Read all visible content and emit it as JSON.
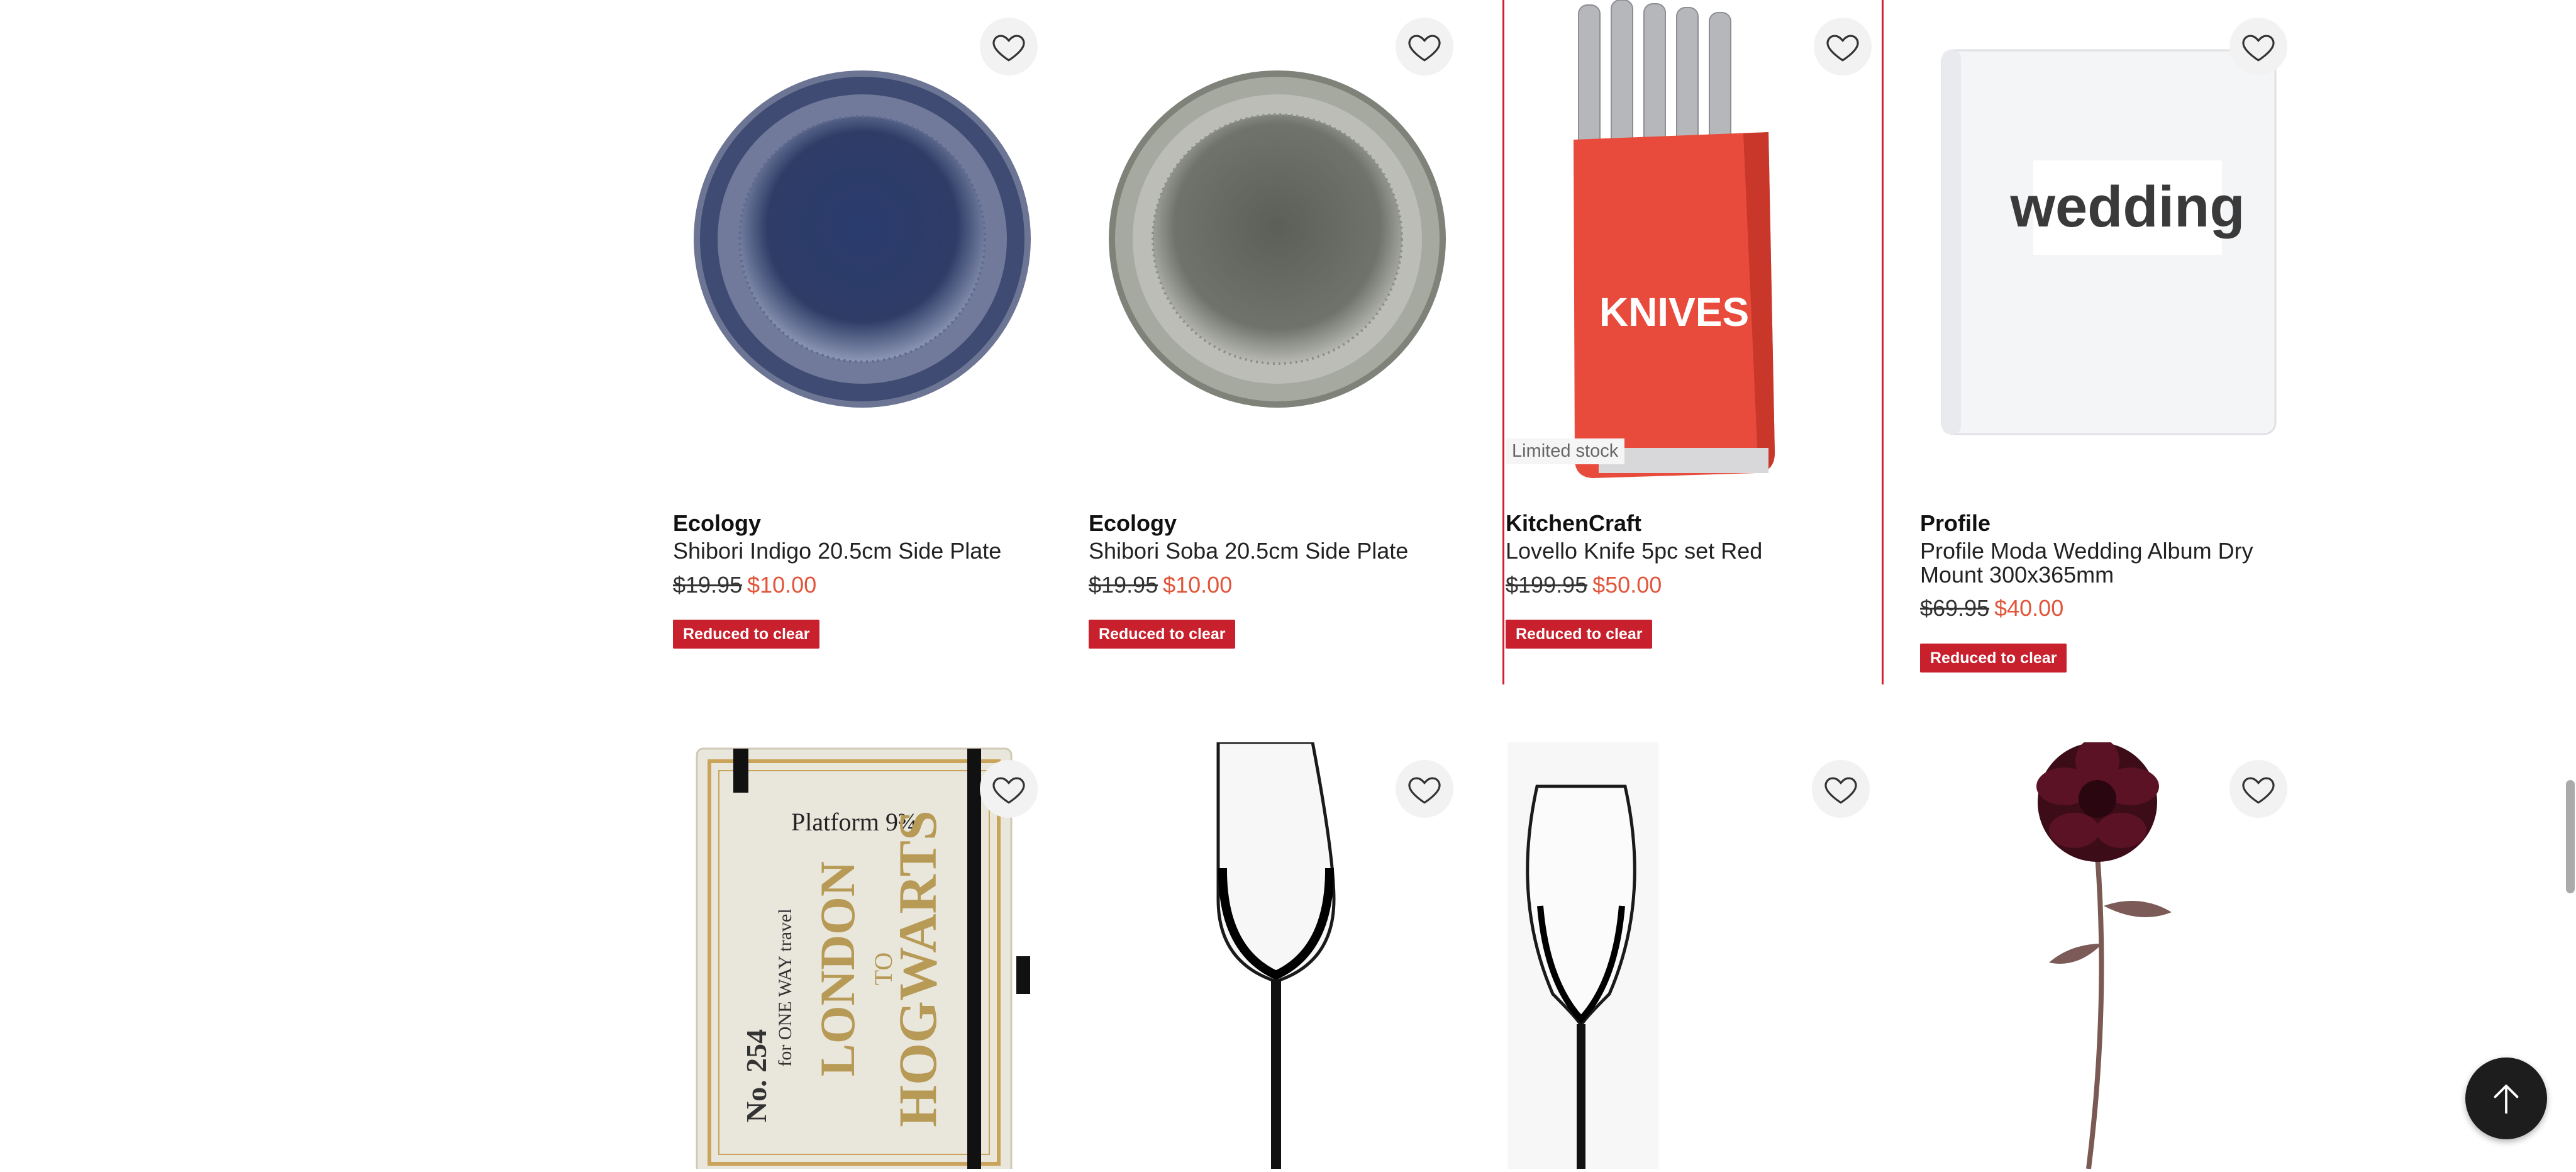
{
  "colors": {
    "badge": "#c8202d",
    "sale_price": "#e1553a",
    "highlight_border": "#d0202b",
    "back_to_top": "#1d1d1d"
  },
  "products": [
    {
      "brand": "Ecology",
      "name": "Shibori Indigo 20.5cm Side Plate",
      "was_price": "$19.95",
      "price": "$10.00",
      "badge": "Reduced to clear",
      "image": "indigo-plate"
    },
    {
      "brand": "Ecology",
      "name": "Shibori Soba 20.5cm Side Plate",
      "was_price": "$19.95",
      "price": "$10.00",
      "badge": "Reduced to clear",
      "image": "soba-plate"
    },
    {
      "brand": "KitchenCraft",
      "name": "Lovello Knife 5pc set Red",
      "was_price": "$199.95",
      "price": "$50.00",
      "badge": "Reduced to clear",
      "stock_label": "Limited stock",
      "image": "knife-block",
      "image_text": "KNIVES"
    },
    {
      "brand": "Profile",
      "name": "Profile Moda Wedding Album Dry Mount 300x365mm",
      "was_price": "$69.95",
      "price": "$40.00",
      "badge": "Reduced to clear",
      "image": "wedding-album",
      "image_text": "wedding"
    }
  ],
  "row2_images": [
    {
      "image": "hogwarts-notebook",
      "image_text": [
        "Platform 9¾",
        "LONDON",
        "TO",
        "HOGWARTS",
        "No. 254",
        "for ONE WAY travel"
      ]
    },
    {
      "image": "wine-glass"
    },
    {
      "image": "champagne-flute"
    },
    {
      "image": "dahlia-stem"
    }
  ],
  "icons": {
    "wishlist": "heart-icon",
    "back_to_top": "arrow-up-icon"
  }
}
